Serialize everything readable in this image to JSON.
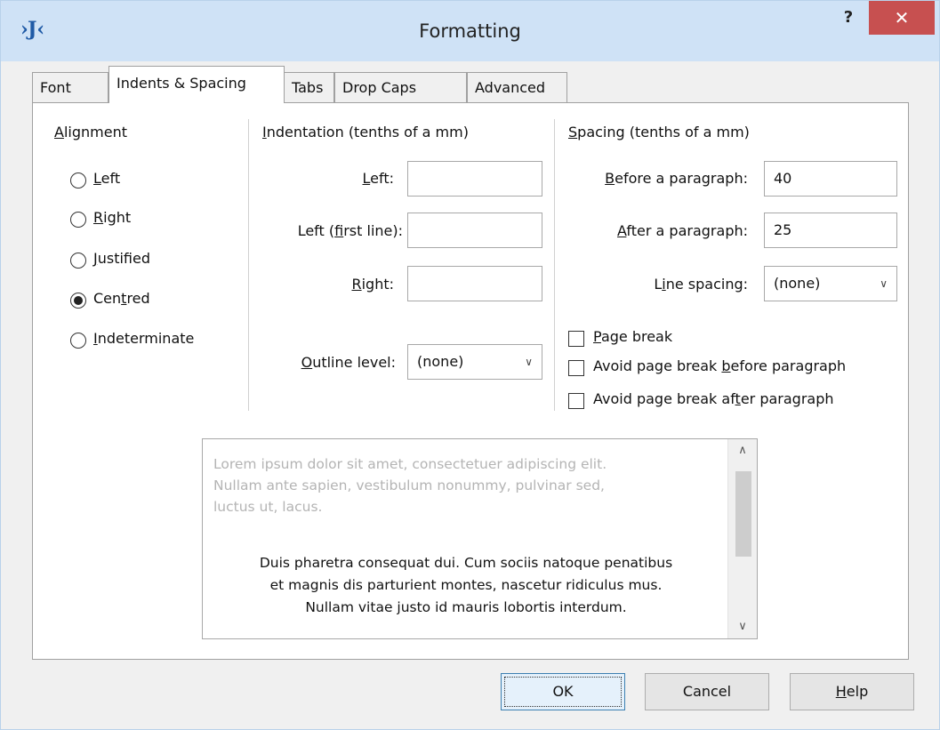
{
  "window": {
    "title": "Formatting",
    "help_label": "?",
    "close_label": "✕",
    "app_icon": "›J‹"
  },
  "tabs": [
    {
      "label": "Font",
      "active": false
    },
    {
      "label": "Indents & Spacing",
      "active": true
    },
    {
      "label": "Tabs",
      "active": false
    },
    {
      "label": "Drop Caps",
      "active": false
    },
    {
      "label": "Advanced",
      "active": false
    }
  ],
  "alignment": {
    "title": "Alignment",
    "options": [
      {
        "label": "Left",
        "checked": false
      },
      {
        "label": "Right",
        "checked": false
      },
      {
        "label": "Justified",
        "checked": false
      },
      {
        "label": "Centred",
        "checked": true
      },
      {
        "label": "Indeterminate",
        "checked": false
      }
    ]
  },
  "indentation": {
    "title": "Indentation (tenths of a mm)",
    "left_label": "Left:",
    "left_value": "",
    "first_line_label": "Left (first line):",
    "first_line_value": "",
    "right_label": "Right:",
    "right_value": "",
    "outline_label": "Outline level:",
    "outline_value": "(none)"
  },
  "spacing": {
    "title": "Spacing (tenths of a mm)",
    "before_label": "Before a paragraph:",
    "before_value": "40",
    "after_label": "After a paragraph:",
    "after_value": "25",
    "line_spacing_label": "Line spacing:",
    "line_spacing_value": "(none)",
    "checkboxes": [
      {
        "label": "Page break",
        "checked": false
      },
      {
        "label": "Avoid page break before paragraph",
        "checked": false
      },
      {
        "label": "Avoid page break after paragraph",
        "checked": false
      }
    ]
  },
  "preview": {
    "previous_paragraph": [
      "Lorem ipsum dolor sit amet, consectetuer adipiscing elit.",
      "Nullam ante sapien, vestibulum nonummy, pulvinar sed,",
      "luctus ut, lacus."
    ],
    "current_paragraph": [
      "Duis pharetra consequat dui. Cum sociis natoque penatibus",
      "et magnis dis parturient montes, nascetur ridiculus mus.",
      "Nullam vitae justo id mauris lobortis interdum."
    ]
  },
  "buttons": {
    "ok": "OK",
    "cancel": "Cancel",
    "help": "Help"
  }
}
